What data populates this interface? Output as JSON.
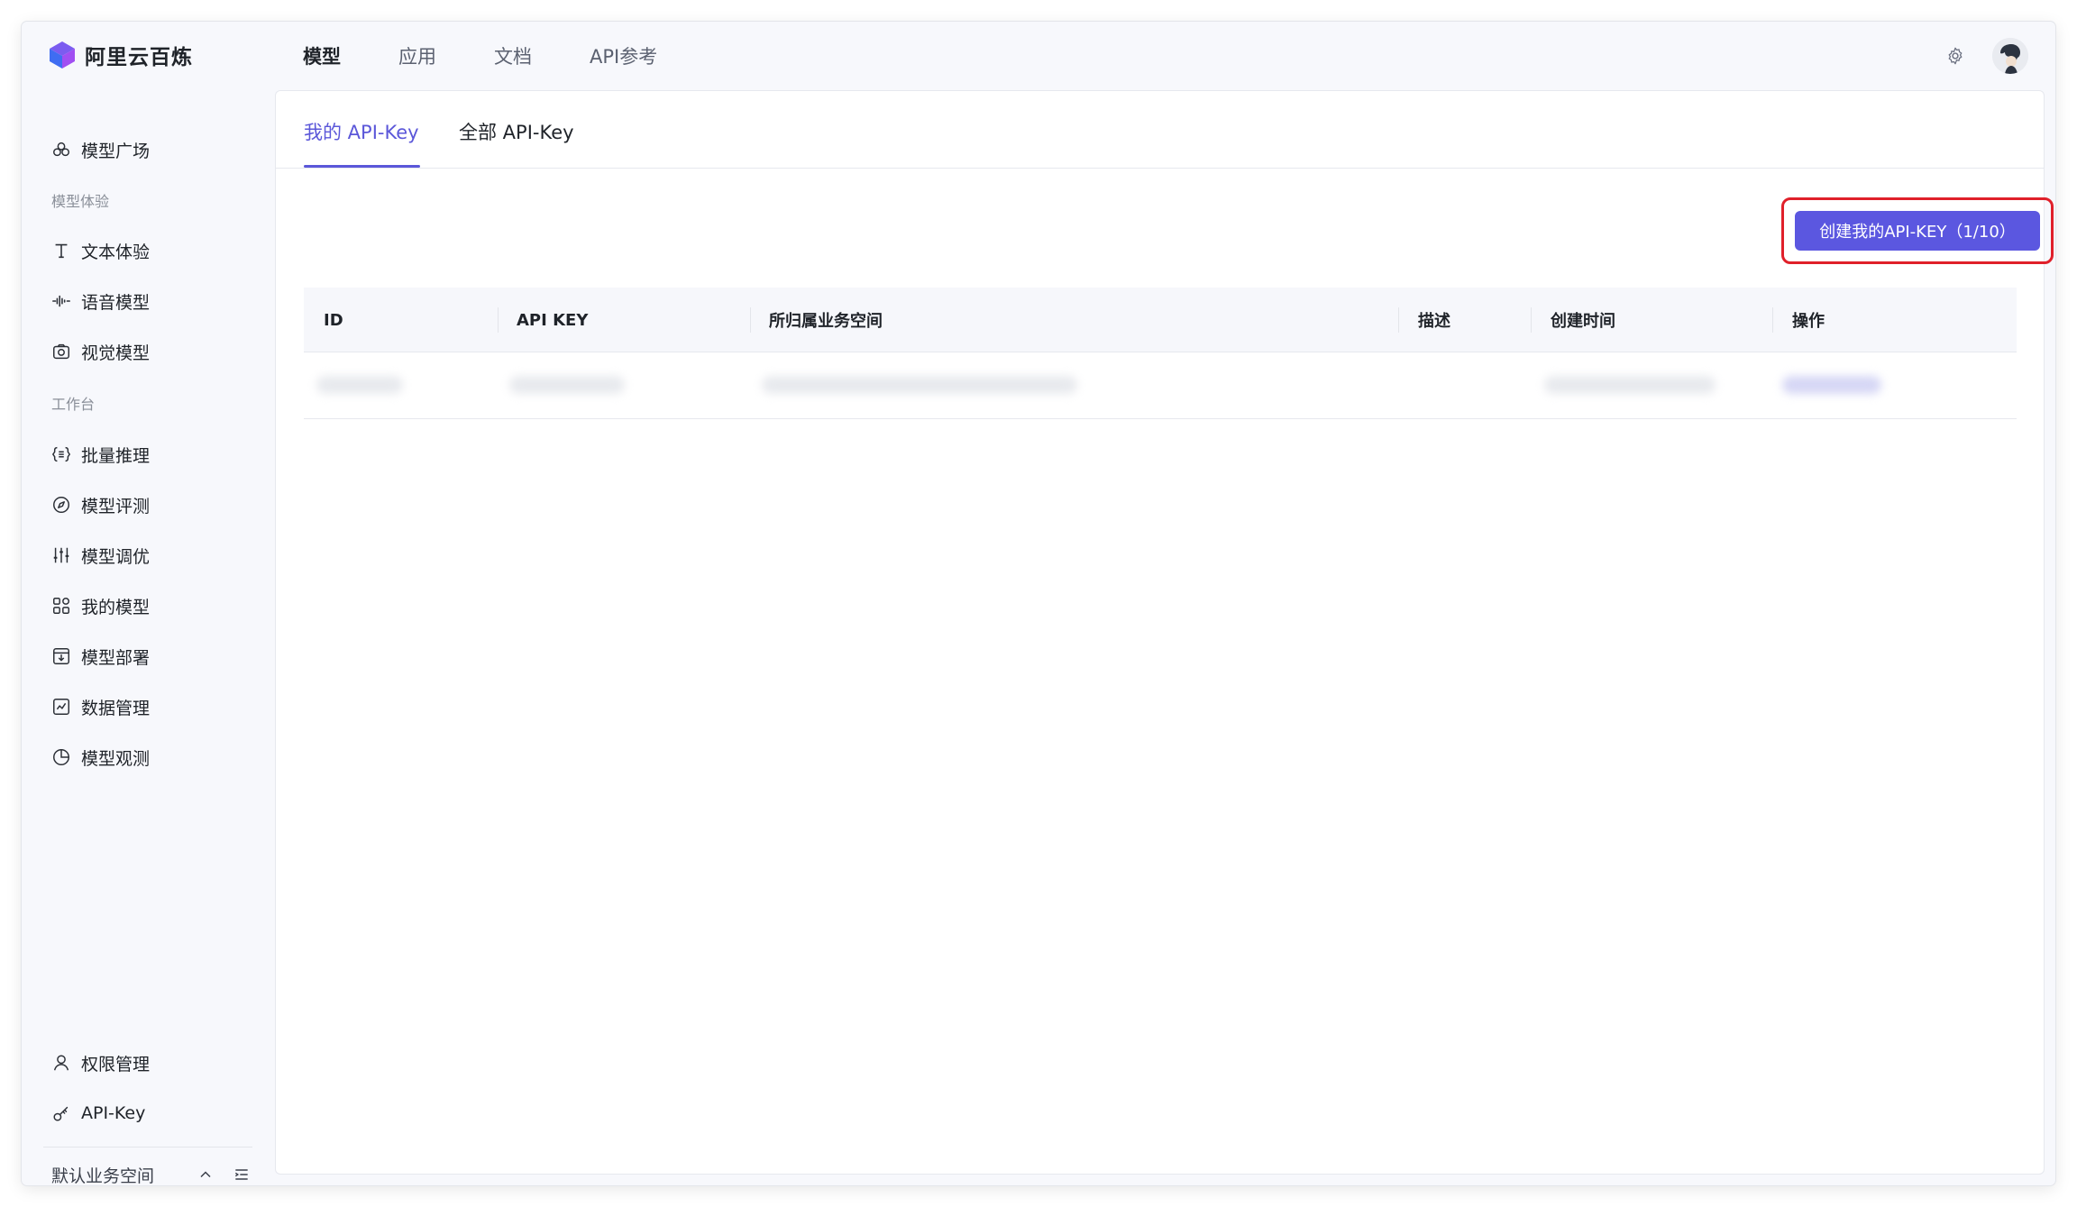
{
  "app": {
    "logo_text": "阿里云百炼"
  },
  "topnav": {
    "items": [
      {
        "label": "模型",
        "active": true
      },
      {
        "label": "应用",
        "active": false
      },
      {
        "label": "文档",
        "active": false
      },
      {
        "label": "API参考",
        "active": false
      }
    ]
  },
  "sidebar": {
    "model_square": "模型广场",
    "group_experience": "模型体验",
    "text_exp": "文本体验",
    "voice_model": "语音模型",
    "vision_model": "视觉模型",
    "group_workbench": "工作台",
    "batch_infer": "批量推理",
    "model_eval": "模型评测",
    "model_tune": "模型调优",
    "my_models": "我的模型",
    "model_deploy": "模型部署",
    "data_mgmt": "数据管理",
    "model_observe": "模型观测",
    "permissions": "权限管理",
    "api_key": "API-Key",
    "workspace": "默认业务空间"
  },
  "tabs": {
    "my_key": "我的 API-Key",
    "all_key": "全部 API-Key"
  },
  "create_button": "创建我的API-KEY（1/10）",
  "table": {
    "headers": [
      "ID",
      "API KEY",
      "所归属业务空间",
      "描述",
      "创建时间",
      "操作"
    ]
  },
  "colors": {
    "accent": "#5b57e0",
    "highlight": "#e0202a"
  }
}
